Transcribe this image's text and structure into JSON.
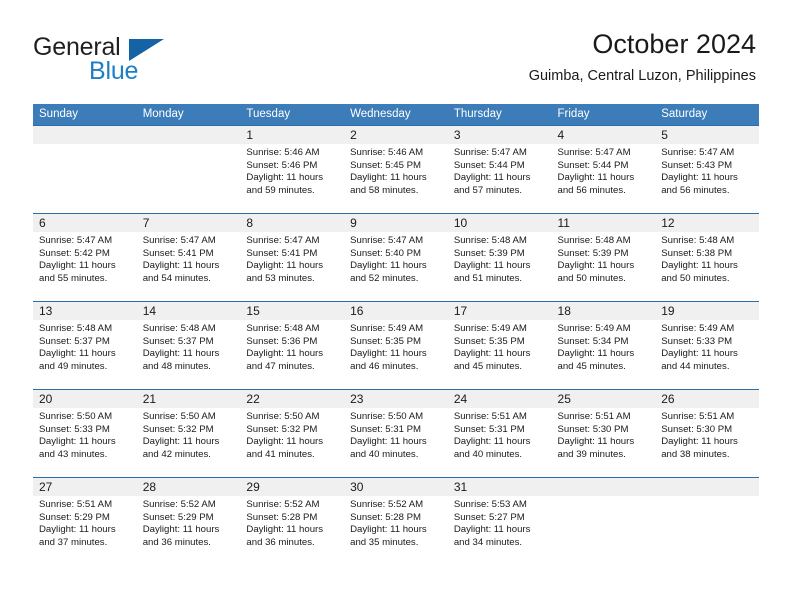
{
  "branding": {
    "logo_primary": "General",
    "logo_secondary": "Blue",
    "logo_triangle_color": "#1464a5",
    "logo_blue_color": "#1d7ec4"
  },
  "header": {
    "title": "October 2024",
    "subtitle": "Guimba, Central Luzon, Philippines"
  },
  "theme": {
    "header_row_bg": "#3c7cb8",
    "row_divider": "#2b6cab",
    "day_band_bg": "#f0f0f0",
    "text": "#1a1a1a"
  },
  "calendar": {
    "weekdays": [
      "Sunday",
      "Monday",
      "Tuesday",
      "Wednesday",
      "Thursday",
      "Friday",
      "Saturday"
    ],
    "labels": {
      "sunrise_prefix": "Sunrise:",
      "sunset_prefix": "Sunset:",
      "daylight_prefix": "Daylight:"
    },
    "weeks": [
      [
        {
          "day": "",
          "sunrise": "",
          "sunset": "",
          "daylight": ""
        },
        {
          "day": "",
          "sunrise": "",
          "sunset": "",
          "daylight": ""
        },
        {
          "day": "1",
          "sunrise": "Sunrise: 5:46 AM",
          "sunset": "Sunset: 5:46 PM",
          "daylight": "Daylight: 11 hours and 59 minutes."
        },
        {
          "day": "2",
          "sunrise": "Sunrise: 5:46 AM",
          "sunset": "Sunset: 5:45 PM",
          "daylight": "Daylight: 11 hours and 58 minutes."
        },
        {
          "day": "3",
          "sunrise": "Sunrise: 5:47 AM",
          "sunset": "Sunset: 5:44 PM",
          "daylight": "Daylight: 11 hours and 57 minutes."
        },
        {
          "day": "4",
          "sunrise": "Sunrise: 5:47 AM",
          "sunset": "Sunset: 5:44 PM",
          "daylight": "Daylight: 11 hours and 56 minutes."
        },
        {
          "day": "5",
          "sunrise": "Sunrise: 5:47 AM",
          "sunset": "Sunset: 5:43 PM",
          "daylight": "Daylight: 11 hours and 56 minutes."
        }
      ],
      [
        {
          "day": "6",
          "sunrise": "Sunrise: 5:47 AM",
          "sunset": "Sunset: 5:42 PM",
          "daylight": "Daylight: 11 hours and 55 minutes."
        },
        {
          "day": "7",
          "sunrise": "Sunrise: 5:47 AM",
          "sunset": "Sunset: 5:41 PM",
          "daylight": "Daylight: 11 hours and 54 minutes."
        },
        {
          "day": "8",
          "sunrise": "Sunrise: 5:47 AM",
          "sunset": "Sunset: 5:41 PM",
          "daylight": "Daylight: 11 hours and 53 minutes."
        },
        {
          "day": "9",
          "sunrise": "Sunrise: 5:47 AM",
          "sunset": "Sunset: 5:40 PM",
          "daylight": "Daylight: 11 hours and 52 minutes."
        },
        {
          "day": "10",
          "sunrise": "Sunrise: 5:48 AM",
          "sunset": "Sunset: 5:39 PM",
          "daylight": "Daylight: 11 hours and 51 minutes."
        },
        {
          "day": "11",
          "sunrise": "Sunrise: 5:48 AM",
          "sunset": "Sunset: 5:39 PM",
          "daylight": "Daylight: 11 hours and 50 minutes."
        },
        {
          "day": "12",
          "sunrise": "Sunrise: 5:48 AM",
          "sunset": "Sunset: 5:38 PM",
          "daylight": "Daylight: 11 hours and 50 minutes."
        }
      ],
      [
        {
          "day": "13",
          "sunrise": "Sunrise: 5:48 AM",
          "sunset": "Sunset: 5:37 PM",
          "daylight": "Daylight: 11 hours and 49 minutes."
        },
        {
          "day": "14",
          "sunrise": "Sunrise: 5:48 AM",
          "sunset": "Sunset: 5:37 PM",
          "daylight": "Daylight: 11 hours and 48 minutes."
        },
        {
          "day": "15",
          "sunrise": "Sunrise: 5:48 AM",
          "sunset": "Sunset: 5:36 PM",
          "daylight": "Daylight: 11 hours and 47 minutes."
        },
        {
          "day": "16",
          "sunrise": "Sunrise: 5:49 AM",
          "sunset": "Sunset: 5:35 PM",
          "daylight": "Daylight: 11 hours and 46 minutes."
        },
        {
          "day": "17",
          "sunrise": "Sunrise: 5:49 AM",
          "sunset": "Sunset: 5:35 PM",
          "daylight": "Daylight: 11 hours and 45 minutes."
        },
        {
          "day": "18",
          "sunrise": "Sunrise: 5:49 AM",
          "sunset": "Sunset: 5:34 PM",
          "daylight": "Daylight: 11 hours and 45 minutes."
        },
        {
          "day": "19",
          "sunrise": "Sunrise: 5:49 AM",
          "sunset": "Sunset: 5:33 PM",
          "daylight": "Daylight: 11 hours and 44 minutes."
        }
      ],
      [
        {
          "day": "20",
          "sunrise": "Sunrise: 5:50 AM",
          "sunset": "Sunset: 5:33 PM",
          "daylight": "Daylight: 11 hours and 43 minutes."
        },
        {
          "day": "21",
          "sunrise": "Sunrise: 5:50 AM",
          "sunset": "Sunset: 5:32 PM",
          "daylight": "Daylight: 11 hours and 42 minutes."
        },
        {
          "day": "22",
          "sunrise": "Sunrise: 5:50 AM",
          "sunset": "Sunset: 5:32 PM",
          "daylight": "Daylight: 11 hours and 41 minutes."
        },
        {
          "day": "23",
          "sunrise": "Sunrise: 5:50 AM",
          "sunset": "Sunset: 5:31 PM",
          "daylight": "Daylight: 11 hours and 40 minutes."
        },
        {
          "day": "24",
          "sunrise": "Sunrise: 5:51 AM",
          "sunset": "Sunset: 5:31 PM",
          "daylight": "Daylight: 11 hours and 40 minutes."
        },
        {
          "day": "25",
          "sunrise": "Sunrise: 5:51 AM",
          "sunset": "Sunset: 5:30 PM",
          "daylight": "Daylight: 11 hours and 39 minutes."
        },
        {
          "day": "26",
          "sunrise": "Sunrise: 5:51 AM",
          "sunset": "Sunset: 5:30 PM",
          "daylight": "Daylight: 11 hours and 38 minutes."
        }
      ],
      [
        {
          "day": "27",
          "sunrise": "Sunrise: 5:51 AM",
          "sunset": "Sunset: 5:29 PM",
          "daylight": "Daylight: 11 hours and 37 minutes."
        },
        {
          "day": "28",
          "sunrise": "Sunrise: 5:52 AM",
          "sunset": "Sunset: 5:29 PM",
          "daylight": "Daylight: 11 hours and 36 minutes."
        },
        {
          "day": "29",
          "sunrise": "Sunrise: 5:52 AM",
          "sunset": "Sunset: 5:28 PM",
          "daylight": "Daylight: 11 hours and 36 minutes."
        },
        {
          "day": "30",
          "sunrise": "Sunrise: 5:52 AM",
          "sunset": "Sunset: 5:28 PM",
          "daylight": "Daylight: 11 hours and 35 minutes."
        },
        {
          "day": "31",
          "sunrise": "Sunrise: 5:53 AM",
          "sunset": "Sunset: 5:27 PM",
          "daylight": "Daylight: 11 hours and 34 minutes."
        },
        {
          "day": "",
          "sunrise": "",
          "sunset": "",
          "daylight": ""
        },
        {
          "day": "",
          "sunrise": "",
          "sunset": "",
          "daylight": ""
        }
      ]
    ]
  }
}
